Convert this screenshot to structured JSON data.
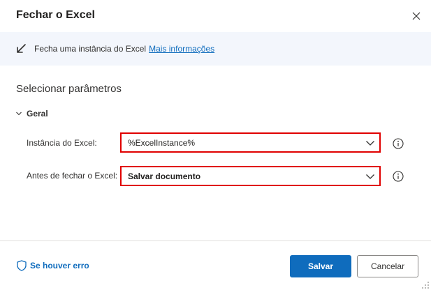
{
  "dialog": {
    "title": "Fechar o Excel",
    "close_icon": "close-icon"
  },
  "info": {
    "icon": "arrow-diagonal-icon",
    "text": "Fecha uma instância do Excel",
    "link": "Mais informações"
  },
  "section": {
    "title": "Selecionar parâmetros"
  },
  "group": {
    "label": "Geral",
    "expanded": true
  },
  "params": [
    {
      "label": "Instância do Excel:",
      "value": "%ExcelInstance%"
    },
    {
      "label": "Antes de fechar o Excel:",
      "value": "Salvar documento"
    }
  ],
  "footer": {
    "error_link": "Se houver erro",
    "save_label": "Salvar",
    "cancel_label": "Cancelar"
  },
  "colors": {
    "accent": "#0f6cbd",
    "highlight": "#e00000",
    "info_bg": "#f3f6fc"
  }
}
